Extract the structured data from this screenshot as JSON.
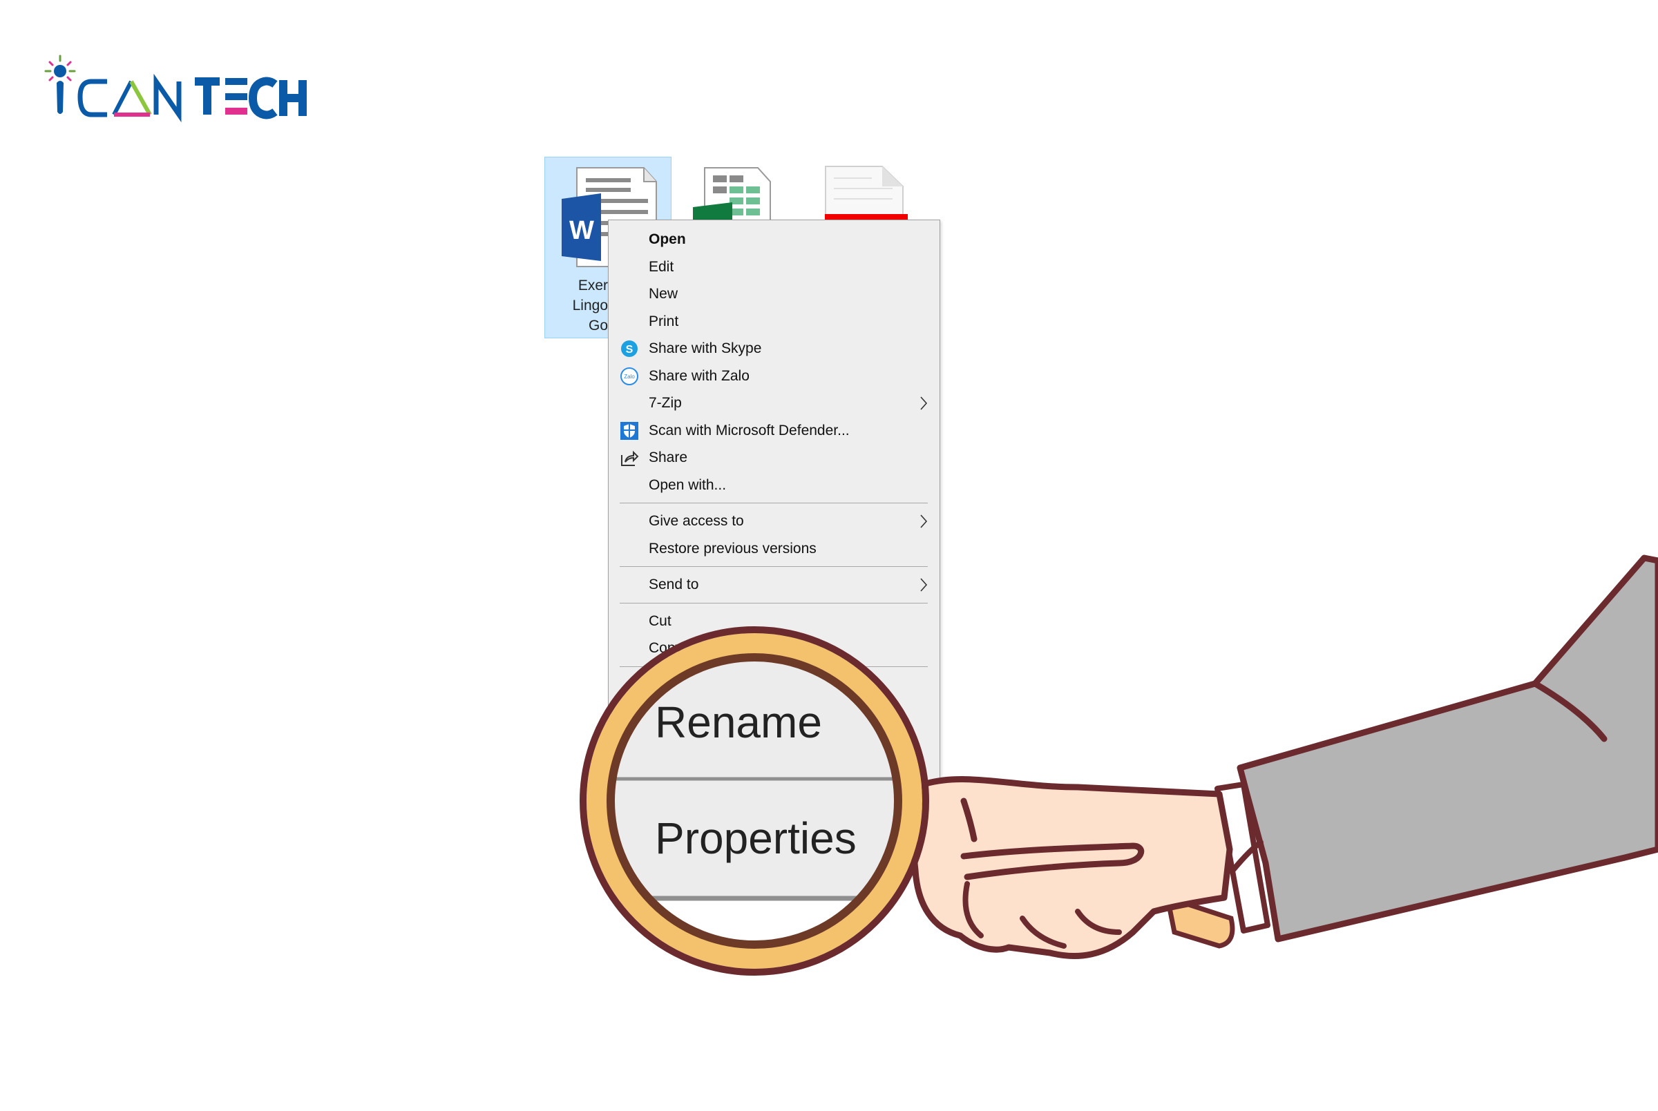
{
  "logo": {
    "text": "ICANTECH",
    "colors": {
      "blue": "#0a5aa8",
      "pink": "#e0318f",
      "green": "#8cc63f"
    }
  },
  "desktop": {
    "files": [
      {
        "type": "word",
        "selected": true,
        "label_lines": [
          "Exer",
          "Lingo",
          "Go"
        ]
      },
      {
        "type": "excel"
      },
      {
        "type": "pdf"
      }
    ],
    "selection_color": "#cce8ff"
  },
  "context_menu": {
    "groups": [
      [
        {
          "label": "Open",
          "bold": true
        },
        {
          "label": "Edit"
        },
        {
          "label": "New"
        },
        {
          "label": "Print"
        },
        {
          "label": "Share with Skype",
          "icon": "skype-icon"
        },
        {
          "label": "Share with Zalo",
          "icon": "zalo-icon"
        },
        {
          "label": "7-Zip",
          "submenu": true
        },
        {
          "label": "Scan with Microsoft Defender...",
          "icon": "defender-shield-icon"
        },
        {
          "label": "Share",
          "icon": "share-icon"
        },
        {
          "label": "Open with..."
        }
      ],
      [
        {
          "label": "Give access to",
          "submenu": true
        },
        {
          "label": "Restore previous versions"
        }
      ],
      [
        {
          "label": "Send to",
          "submenu": true
        }
      ],
      [
        {
          "label": "Cut"
        },
        {
          "label": "Copy"
        }
      ]
    ],
    "zalo_icon_text": "Zalo",
    "skype_icon_text": "S"
  },
  "magnifier": {
    "items": [
      "Rename",
      "Properties"
    ],
    "ring_colors": {
      "outline": "#6b2a2e",
      "gold": "#f4c26c",
      "inner": "#6e3a28"
    }
  }
}
